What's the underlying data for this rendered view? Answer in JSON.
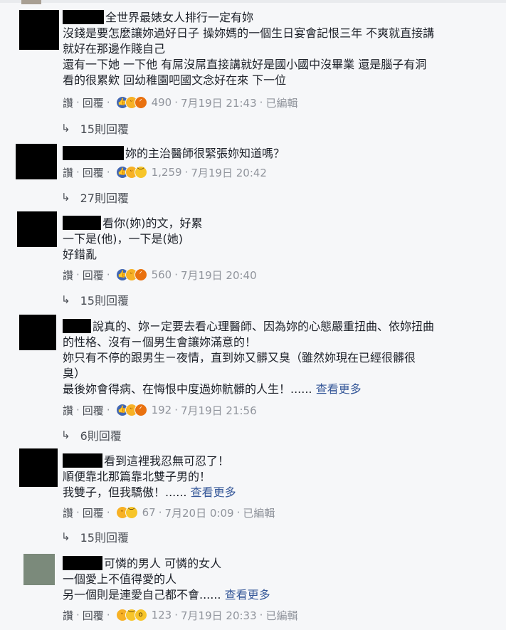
{
  "comments": [
    {
      "text_lines": [
        "全世界最婊女人排行一定有妳",
        "沒錢是要怎麼讓妳過好日子 操妳媽的一個生日宴會記恨三年 不爽就直接講",
        "就好在那邊作賤自己",
        "還有一下她 一下他 有屌沒屌直接講就好是國小國中沒畢業 還是腦子有洞",
        "看的很累欸 回幼稚園吧國文念好在來 下一位"
      ],
      "reactions": [
        "like",
        "haha",
        "angry"
      ],
      "count": "490",
      "time": "7月19日 21:43",
      "edited": "已編輯",
      "replies": "15則回覆"
    },
    {
      "text_lines": [
        "妳的主治醫師很緊張妳知道嗎？"
      ],
      "reactions": [
        "like",
        "haha",
        "sad"
      ],
      "count": "1,259",
      "time": "7月19日 20:42",
      "edited": "",
      "replies": "27則回覆"
    },
    {
      "text_lines": [
        "看你(妳)的文，好累",
        "一下是(他)，一下是(她)",
        "好錯亂"
      ],
      "reactions": [
        "like",
        "haha",
        "angry"
      ],
      "count": "560",
      "time": "7月19日 20:40",
      "edited": "",
      "replies": "15則回覆"
    },
    {
      "text_lines": [
        "說真的、妳ㄧ定要去看心理醫師、因為妳的心態嚴重扭曲、依妳扭曲",
        "的性格、沒有ㄧ個男生會讓妳滿意的！",
        "妳只有不停的跟男生ㄧ夜情，直到妳又髒又臭（雖然妳現在已經很髒很",
        "臭）",
        "最後妳會得病、在悔恨中度過妳骯髒的人生！......"
      ],
      "see_more": "查看更多",
      "reactions": [
        "like",
        "haha",
        "angry"
      ],
      "count": "192",
      "time": "7月19日 21:56",
      "edited": "",
      "replies": "6則回覆"
    },
    {
      "text_lines": [
        "看到這裡我忍無可忍了！",
        "順便靠北那篇靠北雙子男的！",
        "我雙子，但我驕傲！......"
      ],
      "see_more": "查看更多",
      "reactions": [
        "haha",
        "sad"
      ],
      "count": "67",
      "time": "7月20日 0:09",
      "edited": "已編輯",
      "replies": "15則回覆"
    },
    {
      "text_lines": [
        "可憐的男人 可憐的女人",
        "一個愛上不值得愛的人",
        "另一個則是連愛自己都不會......"
      ],
      "see_more": "查看更多",
      "reactions": [
        "haha",
        "sad",
        "wow"
      ],
      "count": "123",
      "time": "7月19日 20:33",
      "edited": "已編輯",
      "replies": ""
    }
  ],
  "actions": {
    "like": "讚",
    "reply": "回覆"
  },
  "icons": {
    "reply_arrow": "reply-arrow-icon",
    "like": "like-reaction-icon",
    "haha": "haha-reaction-icon",
    "angry": "angry-reaction-icon",
    "sad": "sad-reaction-icon",
    "wow": "wow-reaction-icon"
  },
  "colors": {
    "background": "#f6f7f9",
    "meta": "#90949c",
    "link": "#365899",
    "like": "#4267b2"
  }
}
